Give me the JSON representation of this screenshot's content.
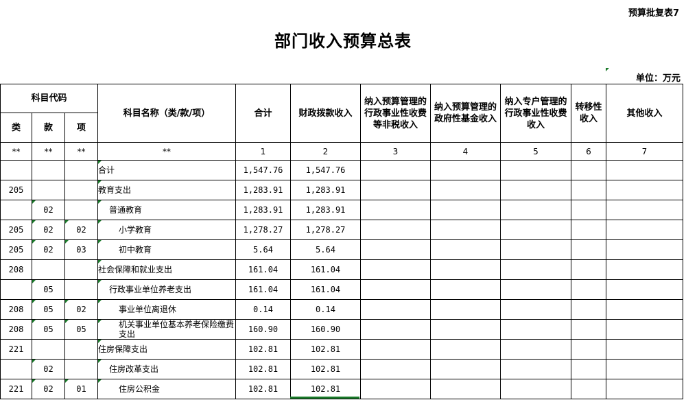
{
  "form_code": "预算批复表7",
  "title": "部门收入预算总表",
  "unit": "单位：万元",
  "headers": {
    "code_group": "科目代码",
    "lei": "类",
    "kuan": "款",
    "xiang": "项",
    "name": "科目名称（类/款/项）",
    "total": "合计",
    "fiscal": "财政拨款收入",
    "c3": "纳入预算管理的行政事业性收费等非税收入",
    "c4": "纳入预算管理的政府性基金收入",
    "c5": "纳入专户管理的行政事业性收费收入",
    "c6": "转移性收入",
    "c7": "其他收入"
  },
  "mark_row": [
    "**",
    "**",
    "**",
    "**",
    "1",
    "2",
    "3",
    "4",
    "5",
    "6",
    "7"
  ],
  "chart_data": {
    "type": "table",
    "title": "部门收入预算总表",
    "columns": [
      "类",
      "款",
      "项",
      "科目名称（类/款/项）",
      "合计",
      "财政拨款收入",
      "纳入预算管理的行政事业性收费等非税收入",
      "纳入预算管理的政府性基金收入",
      "纳入专户管理的行政事业性收费收入",
      "转移性收入",
      "其他收入"
    ],
    "rows": [
      {
        "lei": "",
        "kuan": "",
        "xiang": "",
        "name": "合计",
        "indent": 0,
        "total": "1,547.76",
        "fiscal": "1,547.76",
        "c3": "",
        "c4": "",
        "c5": "",
        "c6": "",
        "c7": ""
      },
      {
        "lei": "205",
        "kuan": "",
        "xiang": "",
        "name": "教育支出",
        "indent": 0,
        "total": "1,283.91",
        "fiscal": "1,283.91",
        "c3": "",
        "c4": "",
        "c5": "",
        "c6": "",
        "c7": ""
      },
      {
        "lei": "",
        "kuan": "02",
        "xiang": "",
        "name": "普通教育",
        "indent": 1,
        "total": "1,283.91",
        "fiscal": "1,283.91",
        "c3": "",
        "c4": "",
        "c5": "",
        "c6": "",
        "c7": ""
      },
      {
        "lei": "205",
        "kuan": "02",
        "xiang": "02",
        "name": "小学教育",
        "indent": 2,
        "total": "1,278.27",
        "fiscal": "1,278.27",
        "c3": "",
        "c4": "",
        "c5": "",
        "c6": "",
        "c7": ""
      },
      {
        "lei": "205",
        "kuan": "02",
        "xiang": "03",
        "name": "初中教育",
        "indent": 2,
        "total": "5.64",
        "fiscal": "5.64",
        "c3": "",
        "c4": "",
        "c5": "",
        "c6": "",
        "c7": ""
      },
      {
        "lei": "208",
        "kuan": "",
        "xiang": "",
        "name": "社会保障和就业支出",
        "indent": 0,
        "total": "161.04",
        "fiscal": "161.04",
        "c3": "",
        "c4": "",
        "c5": "",
        "c6": "",
        "c7": ""
      },
      {
        "lei": "",
        "kuan": "05",
        "xiang": "",
        "name": "行政事业单位养老支出",
        "indent": 1,
        "total": "161.04",
        "fiscal": "161.04",
        "c3": "",
        "c4": "",
        "c5": "",
        "c6": "",
        "c7": ""
      },
      {
        "lei": "208",
        "kuan": "05",
        "xiang": "02",
        "name": "事业单位离退休",
        "indent": 2,
        "total": "0.14",
        "fiscal": "0.14",
        "c3": "",
        "c4": "",
        "c5": "",
        "c6": "",
        "c7": ""
      },
      {
        "lei": "208",
        "kuan": "05",
        "xiang": "05",
        "name": "机关事业单位基本养老保险缴费支出",
        "indent": 2,
        "total": "160.90",
        "fiscal": "160.90",
        "c3": "",
        "c4": "",
        "c5": "",
        "c6": "",
        "c7": ""
      },
      {
        "lei": "221",
        "kuan": "",
        "xiang": "",
        "name": "住房保障支出",
        "indent": 0,
        "total": "102.81",
        "fiscal": "102.81",
        "c3": "",
        "c4": "",
        "c5": "",
        "c6": "",
        "c7": ""
      },
      {
        "lei": "",
        "kuan": "02",
        "xiang": "",
        "name": "住房改革支出",
        "indent": 1,
        "total": "102.81",
        "fiscal": "102.81",
        "c3": "",
        "c4": "",
        "c5": "",
        "c6": "",
        "c7": ""
      },
      {
        "lei": "221",
        "kuan": "02",
        "xiang": "01",
        "name": "住房公积金",
        "indent": 2,
        "total": "102.81",
        "fiscal": "102.81",
        "c3": "",
        "c4": "",
        "c5": "",
        "c6": "",
        "c7": ""
      }
    ]
  },
  "colors": {
    "grid_line": "#000000",
    "cell_marker": "#1a7a2a"
  }
}
